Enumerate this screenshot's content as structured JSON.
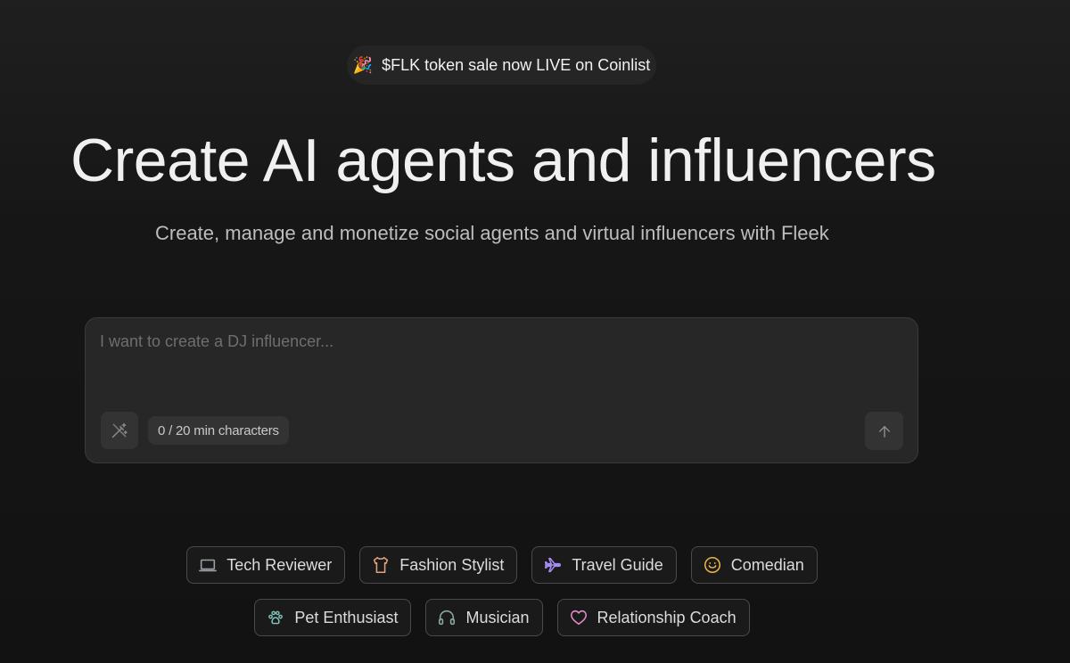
{
  "announcement": {
    "emoji": "🎉",
    "text": "$FLK token sale now LIVE on Coinlist"
  },
  "hero": {
    "title": "Create AI agents and influencers",
    "subtitle": "Create, manage and monetize social agents and virtual influencers with Fleek"
  },
  "prompt": {
    "value": "",
    "placeholder": "I want to create a DJ influencer...",
    "char_count": "0 / 20 min characters",
    "magic_icon": "magic-wand-icon",
    "send_icon": "arrow-up-icon"
  },
  "suggestions": {
    "row1": [
      {
        "label": "Tech Reviewer",
        "icon": "laptop-icon",
        "color": "#9aa0a8"
      },
      {
        "label": "Fashion Stylist",
        "icon": "shirt-icon",
        "color": "#e0a27a"
      },
      {
        "label": "Travel Guide",
        "icon": "plane-icon",
        "color": "#a58cf0"
      },
      {
        "label": "Comedian",
        "icon": "smile-icon",
        "color": "#e8b24a"
      }
    ],
    "row2": [
      {
        "label": "Pet Enthusiast",
        "icon": "paw-icon",
        "color": "#7ec4b8"
      },
      {
        "label": "Musician",
        "icon": "headphones-icon",
        "color": "#8aa8a0"
      },
      {
        "label": "Relationship Coach",
        "icon": "heart-icon",
        "color": "#e58ac8"
      }
    ]
  }
}
